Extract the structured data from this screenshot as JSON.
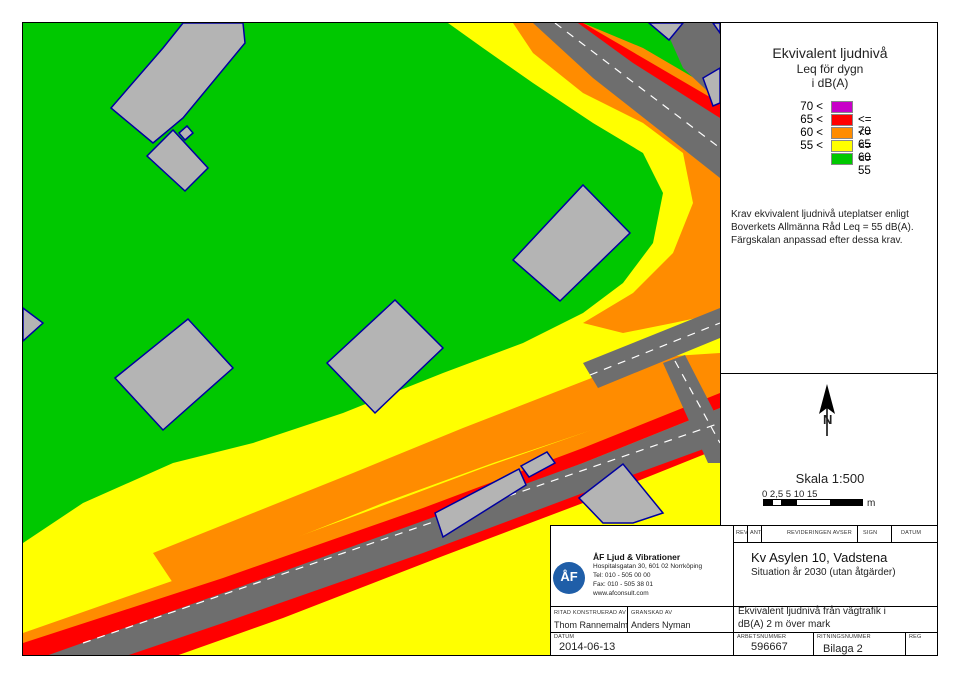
{
  "legend": {
    "title": "Ekvivalent ljudnivå",
    "subtitle1": "Leq för dygn",
    "subtitle2": "i dB(A)",
    "rows": [
      {
        "lo": "70 <",
        "hi": "",
        "color": "#c800c8"
      },
      {
        "lo": "65 <",
        "hi": "<= 70",
        "color": "#ff0000"
      },
      {
        "lo": "60 <",
        "hi": "<= 65",
        "color": "#ff8c00"
      },
      {
        "lo": "55 <",
        "hi": "<= 60",
        "color": "#ffff00"
      },
      {
        "lo": "",
        "hi": "<= 55",
        "color": "#00c800"
      }
    ],
    "krav_lines": [
      "Krav ekvivalent ljudnivå uteplatser enligt",
      "Boverkets Allmänna Råd Leq = 55 dB(A).",
      "Färgskalan anpassad efter dessa krav."
    ]
  },
  "north": {
    "label": "N"
  },
  "scale": {
    "label": "Skala 1:500",
    "ticks": "0 2,5 5     10     15",
    "unit": "m"
  },
  "title_block": {
    "headers": {
      "rev": "REV",
      "ant": "ANT",
      "revid": "REVIDERINGEN AVSER",
      "sign": "SIGN",
      "datum": "DATUM"
    },
    "company": {
      "name": "ÅF Ljud & Vibrationer",
      "address": "Hospitalsgatan 30, 601 02 Norrköping",
      "tel": "Tel: 010 - 505 00 00",
      "fax": "Fax: 010 - 505 38 01",
      "web": "www.afconsult.com",
      "logo_text": "ÅF"
    },
    "project_title": "Kv Asylen 10, Vadstena",
    "project_subtitle": "Situation år 2030 (utan åtgärder)",
    "ritad_label": "RITAD KONSTRUERAD AV",
    "granskad_label": "GRANSKAD AV",
    "ritad_value": "Thom Rannemalm",
    "granskad_value": "Anders Nyman",
    "desc1": "Ekvivalent ljudnivå från vägtrafik i",
    "desc2": "dB(A) 2 m över mark",
    "datum_label": "DATUM",
    "datum_value": "2014-06-13",
    "arbetsnummer_label": "ARBETSNUMMER",
    "arbetsnummer_value": "596667",
    "ritningsnummer_label": "RITNINGSNUMMER",
    "ritningsnummer_value": "Bilaga 2",
    "reg_label": "REG"
  }
}
